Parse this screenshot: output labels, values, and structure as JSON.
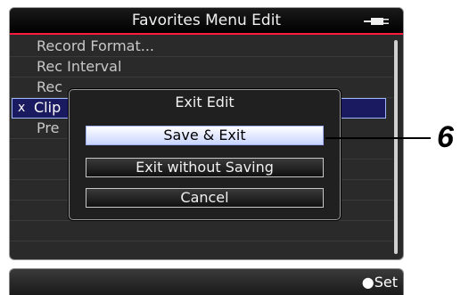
{
  "header": {
    "title": "Favorites Menu Edit",
    "icon": "battery-plug-icon"
  },
  "menu": {
    "items": [
      {
        "label": "Record Format...",
        "mark": ""
      },
      {
        "label": "Rec Interval",
        "mark": ""
      },
      {
        "label": "Rec",
        "mark": ""
      },
      {
        "label": "Clip",
        "mark": "x",
        "selected": true
      },
      {
        "label": "Pre",
        "mark": ""
      }
    ]
  },
  "dialog": {
    "title": "Exit Edit",
    "buttons": [
      {
        "label": "Save & Exit",
        "focused": true
      },
      {
        "label": "Exit without Saving"
      },
      {
        "label": "Cancel"
      }
    ]
  },
  "status": {
    "set_label": "●Set"
  },
  "callout": {
    "number": "6"
  },
  "colors": {
    "title_underline": "#ff1a40",
    "selected_row": "#1a1a60",
    "focused_button": "#c8d4ff"
  }
}
